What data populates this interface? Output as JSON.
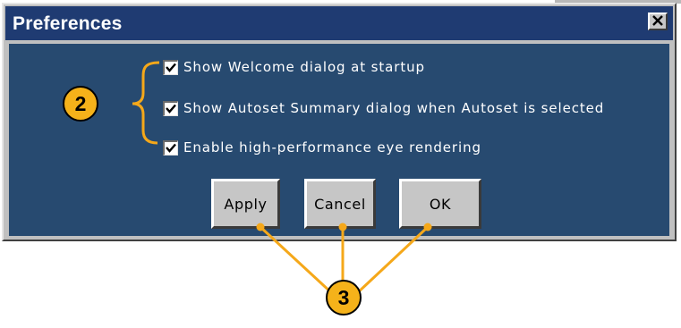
{
  "window": {
    "title": "Preferences",
    "close_glyph": "✕"
  },
  "checkboxes": [
    {
      "label": "Show Welcome dialog at startup",
      "checked": true
    },
    {
      "label": "Show Autoset Summary dialog when Autoset is selected",
      "checked": true
    },
    {
      "label": "Enable high-performance eye rendering",
      "checked": true
    }
  ],
  "buttons": {
    "apply": "Apply",
    "cancel": "Cancel",
    "ok": "OK"
  },
  "callouts": {
    "checkbox_group": "2",
    "buttons_group": "3"
  },
  "colors": {
    "titlebar": "#1f3b72",
    "content": "#274a70",
    "callout": "#f5b21a",
    "leader": "#f5a81a"
  },
  "icons": {
    "close": "close-icon",
    "check": "checkmark-icon"
  }
}
